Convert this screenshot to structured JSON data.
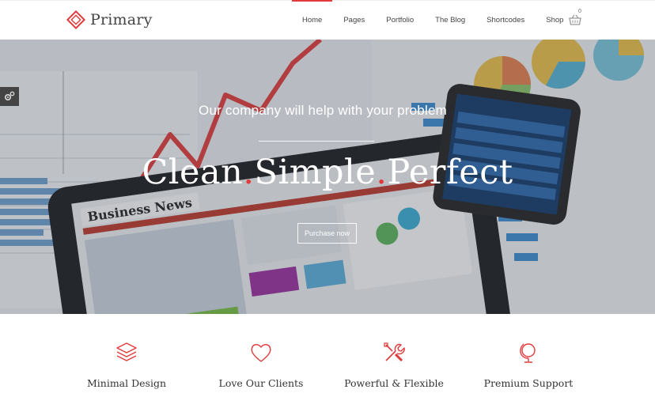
{
  "brand": {
    "name": "Primary",
    "accent": "#e23a3a"
  },
  "nav": {
    "items": [
      {
        "label": "Home",
        "active": true
      },
      {
        "label": "Pages"
      },
      {
        "label": "Portfolio"
      },
      {
        "label": "The Blog"
      },
      {
        "label": "Shortcodes"
      },
      {
        "label": "Shop"
      }
    ],
    "cart_count": "0",
    "cart_icon": "basket-icon"
  },
  "hero": {
    "subtitle": "Our company will help with your problem",
    "title_words": [
      "Clean",
      "Simple",
      "Perfect"
    ],
    "title_separator": ".",
    "button_label": "Purchase now"
  },
  "features": [
    {
      "label": "Minimal Design",
      "icon": "layers-icon"
    },
    {
      "label": "Love Our Clients",
      "icon": "heart-icon"
    },
    {
      "label": "Powerful & Flexible",
      "icon": "tools-icon"
    },
    {
      "label": "Premium Support",
      "icon": "globe-icon"
    }
  ]
}
